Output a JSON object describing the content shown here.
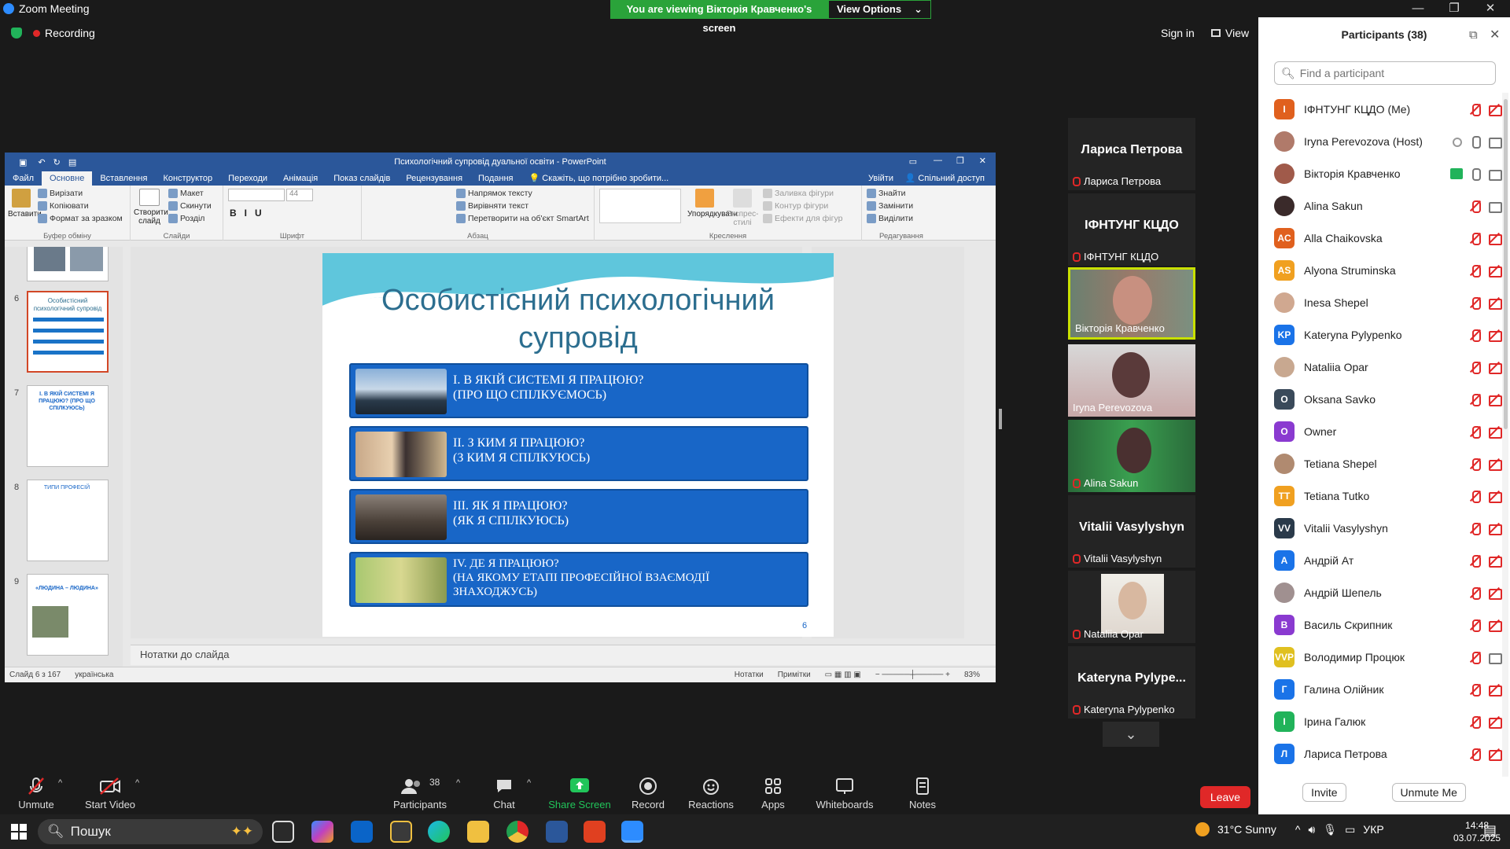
{
  "app": {
    "title": "Zoom Meeting"
  },
  "banner": {
    "text": "You are viewing Вікторія Кравченко's screen",
    "options": "View Options"
  },
  "status": {
    "recording": "Recording",
    "signin": "Sign in",
    "view": "View"
  },
  "ppt": {
    "title": "Психологічний супровід дуальної освіти - PowerPoint",
    "menus": [
      "Файл",
      "Основне",
      "Вставлення",
      "Конструктор",
      "Переходи",
      "Анімація",
      "Показ слайдів",
      "Рецензування",
      "Подання"
    ],
    "tell_me": "Скажіть, що потрібно зробити...",
    "signin": "Увійти",
    "share": "Спільний доступ",
    "ribbon": {
      "paste": "Вставити",
      "cut": "Вирізати",
      "copy": "Копіювати",
      "format": "Формат за зразком",
      "clipboard": "Буфер обміну",
      "new_slide": "Створити слайд",
      "layout": "Макет",
      "reset": "Скинути",
      "section": "Розділ",
      "slides": "Слайди",
      "font_size": "44",
      "font": "Шрифт",
      "text_dir": "Напрямок тексту",
      "align_text": "Вирівняти текст",
      "smartart": "Перетворити на об'єкт SmartArt",
      "paragraph": "Абзац",
      "arrange": "Упорядкувати",
      "quick_styles": "Експрес-стилі",
      "fill": "Заливка фігури",
      "outline": "Контур фігури",
      "effects": "Ефекти для фігур",
      "drawing": "Креслення",
      "find": "Знайти",
      "replace": "Замінити",
      "select": "Виділити",
      "editing": "Редагування"
    },
    "thumbs": [
      {
        "num": "6",
        "title": "Особистісний психологічний супровід"
      },
      {
        "num": "7",
        "title": "І. В ЯКІЙ СИСТЕМІ Я ПРАЦЮЮ? (ПРО ЩО СПІЛКУЮСЬ)"
      },
      {
        "num": "8",
        "title": "ТИПИ ПРОФЕСІЙ"
      },
      {
        "num": "9",
        "title": "«ЛЮДИНА – ЛЮДИНА»"
      }
    ],
    "slide": {
      "title_line1": "Особистісний психологічний",
      "title_line2": "супровід",
      "boxes": [
        {
          "l1": "І. В ЯКІЙ СИСТЕМІ Я ПРАЦЮЮ?",
          "l2": "(ПРО ЩО СПІЛКУЄМОСЬ)",
          "l3": ""
        },
        {
          "l1": "ІІ. З КИМ Я ПРАЦЮЮ?",
          "l2": "(З КИМ Я СПІЛКУЮСЬ)",
          "l3": ""
        },
        {
          "l1": "ІІІ. ЯК Я ПРАЦЮЮ?",
          "l2": "(ЯК Я СПІЛКУЮСЬ)",
          "l3": ""
        },
        {
          "l1": "IV. ДЕ Я ПРАЦЮЮ?",
          "l2": "(НА ЯКОМУ ЕТАПІ ПРОФЕСІЙНОЇ ВЗАЄМОДІЇ",
          "l3": "ЗНАХОДЖУСЬ)"
        }
      ],
      "number": "6"
    },
    "notes": "Нотатки до слайда",
    "statusbar": {
      "slide": "Слайд 6 з 167",
      "lang": "українська",
      "notes": "Нотатки",
      "comments": "Примітки",
      "zoom": "83%"
    }
  },
  "videos": [
    {
      "big": "Лариса Петрова",
      "name": "Лариса Петрова",
      "muted": true
    },
    {
      "big": "ІФНТУНГ КЦДО",
      "name": "ІФНТУНГ КЦДО",
      "muted": true
    },
    {
      "big": "",
      "name": "Вікторія Кравченко",
      "muted": false
    },
    {
      "big": "",
      "name": "Iryna Perevozova",
      "muted": false
    },
    {
      "big": "",
      "name": "Alina Sakun",
      "muted": true
    },
    {
      "big": "Vitalii Vasylyshyn",
      "name": "Vitalii Vasylyshyn",
      "muted": true
    },
    {
      "big": "",
      "name": "Nataliia Opar",
      "muted": true
    },
    {
      "big": "Kateryna Pylype...",
      "name": "Kateryna Pylypenko",
      "muted": true
    }
  ],
  "participants": {
    "title": "Participants (38)",
    "search_placeholder": "Find a participant",
    "list": [
      {
        "initials": "І",
        "color": "#e0601e",
        "name": "ІФНТУНГ КЦДО (Me)"
      },
      {
        "initials": "",
        "color": "#b07a6a",
        "name": "Iryna Perevozova (Host)"
      },
      {
        "initials": "",
        "color": "#a05a4a",
        "name": "Вікторія Кравченко"
      },
      {
        "initials": "",
        "color": "#3a2a2a",
        "name": "Alina Sakun"
      },
      {
        "initials": "AC",
        "color": "#e0601e",
        "name": "Alla Chaikovska"
      },
      {
        "initials": "AS",
        "color": "#f0a020",
        "name": "Alyona Struminska"
      },
      {
        "initials": "",
        "color": "#d0a890",
        "name": "Inesa Shepel"
      },
      {
        "initials": "KP",
        "color": "#1a73e8",
        "name": "Kateryna Pylypenko"
      },
      {
        "initials": "",
        "color": "#c8a890",
        "name": "Nataliia Opar"
      },
      {
        "initials": "O",
        "color": "#3a4a5a",
        "name": "Oksana Savko"
      },
      {
        "initials": "O",
        "color": "#8a3ad0",
        "name": "Owner"
      },
      {
        "initials": "",
        "color": "#b08a70",
        "name": "Tetiana Shepel"
      },
      {
        "initials": "TT",
        "color": "#f0a020",
        "name": "Tetiana Tutko"
      },
      {
        "initials": "VV",
        "color": "#2a3a4a",
        "name": "Vitalii Vasylyshyn"
      },
      {
        "initials": "А",
        "color": "#1a73e8",
        "name": "Андрій Ат"
      },
      {
        "initials": "",
        "color": "#a09090",
        "name": "Андрій Шепель"
      },
      {
        "initials": "В",
        "color": "#8a3ad0",
        "name": "Василь Скрипник"
      },
      {
        "initials": "VVP",
        "color": "#e0c020",
        "name": "Володимир Процюк"
      },
      {
        "initials": "Г",
        "color": "#1a73e8",
        "name": "Галина Олійник"
      },
      {
        "initials": "І",
        "color": "#21b35a",
        "name": "Ірина Галюк"
      },
      {
        "initials": "Л",
        "color": "#1a73e8",
        "name": "Лариса Петрова"
      }
    ],
    "invite": "Invite",
    "unmute_me": "Unmute Me"
  },
  "toolbar": {
    "unmute": "Unmute",
    "start_video": "Start Video",
    "participants": "Participants",
    "participants_count": "38",
    "chat": "Chat",
    "share": "Share Screen",
    "record": "Record",
    "reactions": "Reactions",
    "apps": "Apps",
    "whiteboards": "Whiteboards",
    "notes": "Notes",
    "leave": "Leave"
  },
  "taskbar": {
    "search": "Пошук",
    "weather": "31°C  Sunny",
    "lang": "УКР",
    "time": "14:48",
    "date": "03.07.2025"
  }
}
